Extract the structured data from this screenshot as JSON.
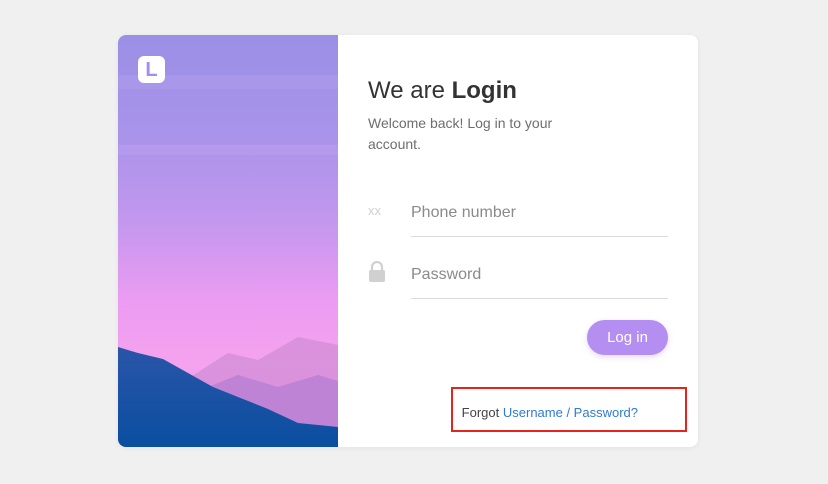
{
  "brand": {
    "logo_letter": "L"
  },
  "heading": {
    "prefix": "We are",
    "bold": "Login",
    "subtitle": "Welcome back! Log in to your account."
  },
  "form": {
    "phone": {
      "icon": "xx",
      "placeholder": "Phone number",
      "value": ""
    },
    "password": {
      "icon_name": "lock-icon",
      "placeholder": "Password",
      "value": ""
    },
    "login_label": "Log in"
  },
  "forgot": {
    "prefix": "Forgot",
    "link_label": "Username / Password?"
  },
  "colors": {
    "background": "#f0f0f0",
    "button": "#b48ef0",
    "link": "#2f7bd1",
    "highlight": "#e8231c"
  }
}
